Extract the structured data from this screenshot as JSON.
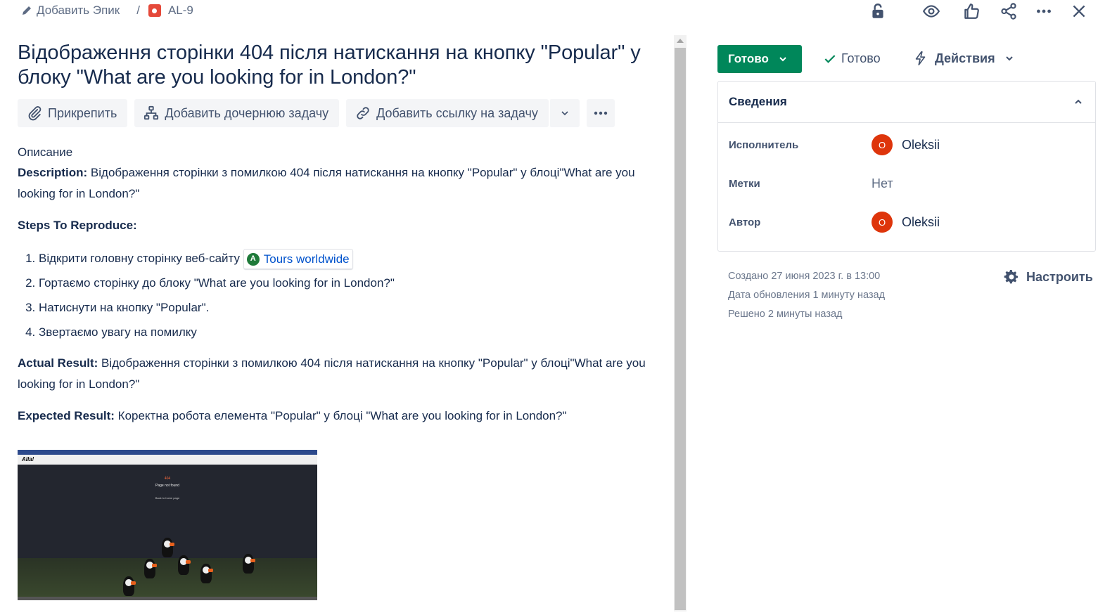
{
  "breadcrumb": {
    "epic_label": "Добавить Эпик",
    "separator": "/",
    "issue_key": "AL-9"
  },
  "header_icons": [
    "lock-icon",
    "watch-eye-icon",
    "vote-thumbs-up-icon",
    "share-icon",
    "more-icon",
    "close-icon"
  ],
  "issue": {
    "title": "Відображення сторінки 404 після натискання на кнопку \"Popular\" у блоку \"What are you looking for in London?\""
  },
  "toolbar": {
    "attach": "Прикрепить",
    "add_child": "Добавить дочернюю задачу",
    "add_link": "Добавить ссылку на задачу"
  },
  "description": {
    "heading": "Описание",
    "desc_label": "Description:",
    "desc_text": " Відображення сторінки з помилкою 404 після натискання на кнопку \"Popular\" у блоці\"What are you looking for in London?\"",
    "steps_label": "Steps To Reproduce:",
    "steps": [
      "Відкрити головну сторінку  веб-сайту",
      "Гортаємо сторінку до блоку \"What are you looking for in London?\"",
      "Натиснути на кнопку  \"Popular\".",
      "Звертаємо увагу на помилку"
    ],
    "step1_link": "Tours worldwide",
    "actual_label": "Actual Result:",
    "actual_text": " Відображення сторінки з помилкою 404 після натискання на кнопку \"Popular\" у блоці\"What are you looking for in London?\"",
    "expected_label": "Expected Result:",
    "expected_text": " Коректна робота елемента \"Popular\" у блоці \"What are you looking for in London?\""
  },
  "attachment": {
    "site_logo": "Alla!",
    "code": "404",
    "message": "Page not found",
    "back": "Back to home page"
  },
  "status": {
    "button": "Готово",
    "resolution": "Готово",
    "actions": "Действия"
  },
  "details": {
    "header": "Сведения",
    "fields": [
      {
        "label": "Исполнитель",
        "value": "Oleksii",
        "avatar": "O"
      },
      {
        "label": "Метки",
        "value": "Нет"
      },
      {
        "label": "Автор",
        "value": "Oleksii",
        "avatar": "O"
      }
    ]
  },
  "meta": {
    "created": "Создано 27 июня 2023 г. в 13:00",
    "updated": "Дата обновления 1 минуту назад",
    "resolved": "Решено 2 минуты назад",
    "configure": "Настроить"
  },
  "colors": {
    "status_green": "#00875a",
    "link_blue": "#0052cc",
    "avatar_red": "#de350b",
    "bug_red": "#e5493a"
  }
}
